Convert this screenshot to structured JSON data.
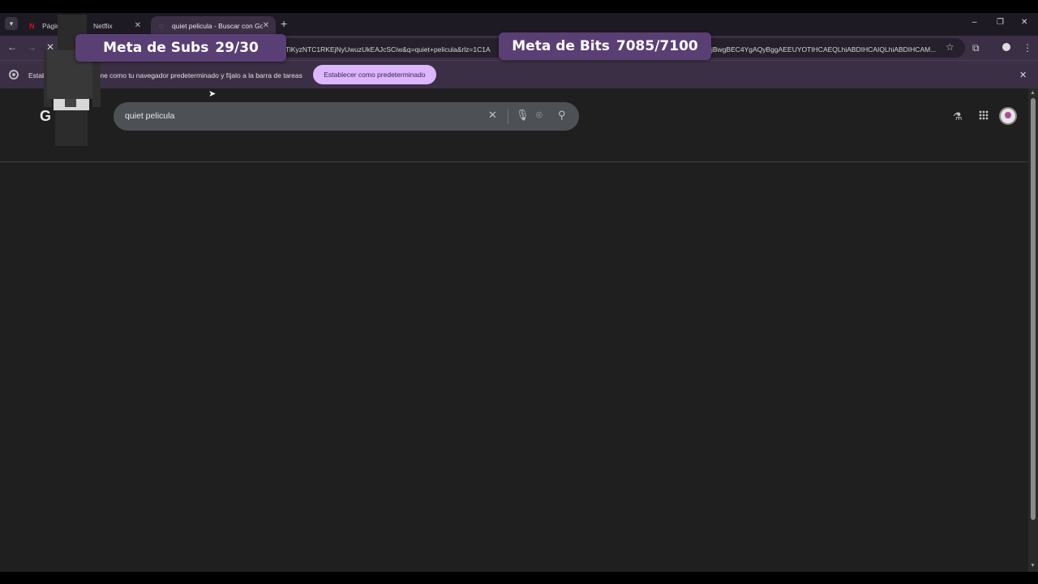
{
  "browser": {
    "tabs": [
      {
        "label_left": "Págir",
        "label_right": "Netflix",
        "icon": "netflix-icon"
      },
      {
        "label": "quiet pelicula - Buscar con Goo",
        "icon": "loading-icon"
      }
    ],
    "window_controls": {
      "minimize": "–",
      "restore": "❐",
      "close": "✕"
    },
    "url_part1": "TiKyzNTC1RKEjNyUwuzUkEAJcSCiw&q=quiet+pelicula&rlz=1C1A",
    "url_part2": "jBwgBEC4YgAQyBggAEEUYOTIHCAEQLhiABDIHCAIQLhiABDIHCAM..."
  },
  "infobar": {
    "text_left": "Estab",
    "text_right": "me como tu navegador predeterminado y fíjalo a la barra de tareas",
    "button_label": "Establecer como predeterminado"
  },
  "search": {
    "logo_fragment": "G",
    "query": "quiet pelicula"
  },
  "overlays": {
    "subs_label": "Meta de Subs",
    "subs_value": "29/30",
    "bits_label": "Meta de Bits",
    "bits_value": "7085/7100"
  },
  "colors": {
    "tab_active": "#3b2f45",
    "overlay_pill": "#5a3f74",
    "button_accent": "#dcb6ff",
    "page_bg": "#1f1f1f"
  }
}
